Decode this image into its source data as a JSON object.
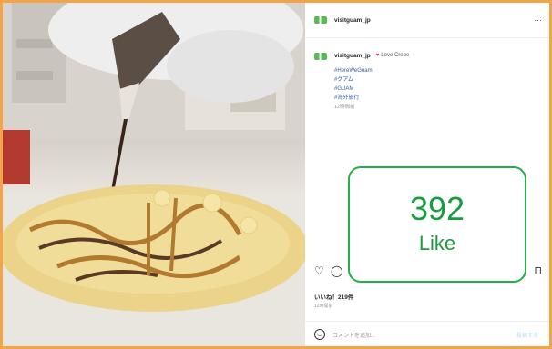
{
  "post": {
    "username": "visitguam_jp",
    "caption_user": "visitguam_jp",
    "caption_tag": "Love Crepe",
    "hashtags": [
      "#HereWeGuam",
      "#グアム",
      "#GUAM",
      "#海外旅行"
    ],
    "caption_time": "12時間前",
    "likes": "いいね！219件",
    "post_time": "12時間前",
    "comment_placeholder": "コメントを追加...",
    "post_button": "投稿する",
    "more_icon": "more-icon"
  },
  "overlay": {
    "count": "392",
    "label": "Like",
    "border_color": "#22b04b",
    "text_color": "#1a9c3e"
  },
  "colors": {
    "page_background": "#f2a44a",
    "brand_green": "#58b957",
    "heart": "#e2435f"
  }
}
